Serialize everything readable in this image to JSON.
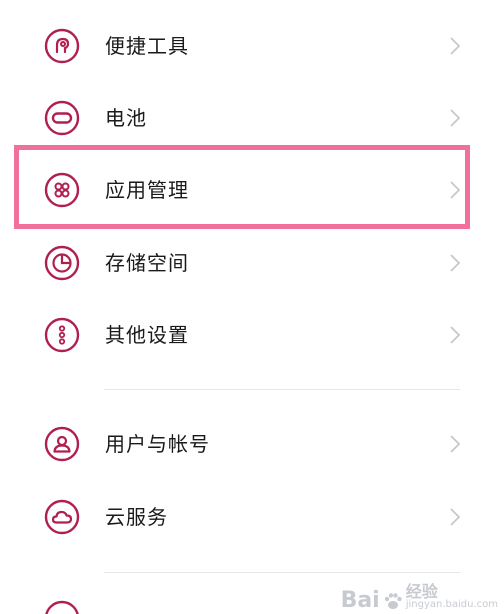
{
  "colors": {
    "accent": "#b0204e",
    "highlight": "#f0709a",
    "chevron": "#c8c8c8",
    "text": "#1a1a1a",
    "divider": "#e6e6e6"
  },
  "settings": {
    "items": [
      {
        "label": "便捷工具",
        "icon": "hand-touch-icon"
      },
      {
        "label": "电池",
        "icon": "battery-icon"
      },
      {
        "label": "应用管理",
        "icon": "apps-grid-icon"
      },
      {
        "label": "存储空间",
        "icon": "pie-chart-icon"
      },
      {
        "label": "其他设置",
        "icon": "more-dots-icon"
      },
      {
        "label": "用户与帐号",
        "icon": "user-icon"
      },
      {
        "label": "云服务",
        "icon": "cloud-icon"
      }
    ]
  },
  "watermark": {
    "logo": "Bai",
    "text": "经验",
    "subtext": "jingyan.baidu.com"
  }
}
